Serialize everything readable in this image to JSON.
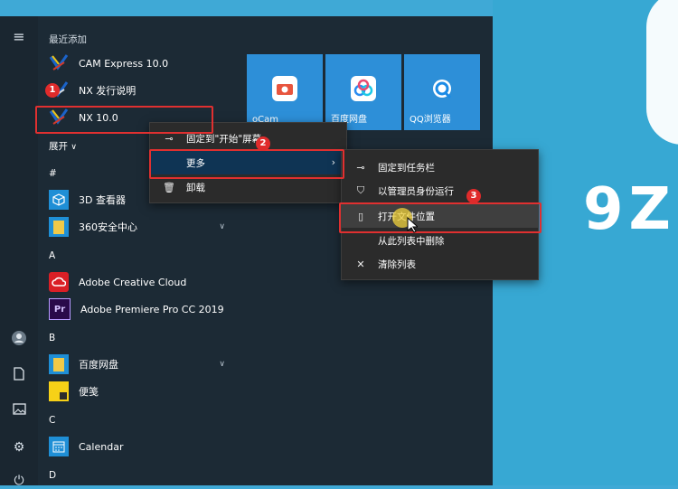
{
  "wallpaper": {
    "logo": "9Z"
  },
  "start_menu": {
    "recent_header": "最近添加",
    "recent_apps": [
      {
        "label": "CAM Express 10.0",
        "icon": "nx-logo-icon"
      },
      {
        "label": "NX 发行说明",
        "icon": "nx-logo-icon"
      },
      {
        "label": "NX 10.0",
        "icon": "nx-logo-icon"
      }
    ],
    "expand_label": "展开",
    "sections": [
      {
        "letter": "#",
        "apps": [
          {
            "label": "3D 查看器",
            "icon": "cube-icon",
            "color": "#1f8fd6"
          },
          {
            "label": "360安全中心",
            "icon": "folder-icon",
            "color": "#f0c948",
            "expandable": true
          }
        ]
      },
      {
        "letter": "A",
        "apps": [
          {
            "label": "Adobe Creative Cloud",
            "icon": "creative-cloud-icon",
            "color": "#da1f26"
          },
          {
            "label": "Adobe Premiere Pro CC 2019",
            "icon": "premiere-icon",
            "color": "#2a0a4a"
          }
        ]
      },
      {
        "letter": "B",
        "apps": [
          {
            "label": "百度网盘",
            "icon": "folder-icon",
            "color": "#f0c948",
            "expandable": true
          },
          {
            "label": "便笺",
            "icon": "sticky-note-icon",
            "color": "#f7d117"
          }
        ]
      },
      {
        "letter": "C",
        "apps": [
          {
            "label": "Calendar",
            "icon": "calendar-icon",
            "color": "#1f8fd6"
          }
        ]
      },
      {
        "letter": "D",
        "apps": []
      }
    ],
    "tiles": [
      {
        "label": "oCam",
        "icon": "ocam-icon"
      },
      {
        "label": "百度网盘",
        "icon": "baidu-netdisk-icon"
      },
      {
        "label": "QQ浏览器",
        "icon": "qq-browser-icon"
      }
    ]
  },
  "context_menu": {
    "items": [
      {
        "label": "固定到\"开始\"屏幕",
        "icon": "pin-icon"
      },
      {
        "label": "更多",
        "icon": ""
      },
      {
        "label": "卸载",
        "icon": "trash-icon"
      }
    ]
  },
  "submenu": {
    "items": [
      {
        "label": "固定到任务栏",
        "icon": "pin-icon"
      },
      {
        "label": "以管理员身份运行",
        "icon": "shield-icon"
      },
      {
        "label": "打开文件位置",
        "icon": "file-icon"
      },
      {
        "label": "从此列表中删除",
        "icon": ""
      },
      {
        "label": "清除列表",
        "icon": "close-icon"
      }
    ]
  },
  "annotations": {
    "badge1": "1",
    "badge2": "2",
    "badge3": "3"
  }
}
